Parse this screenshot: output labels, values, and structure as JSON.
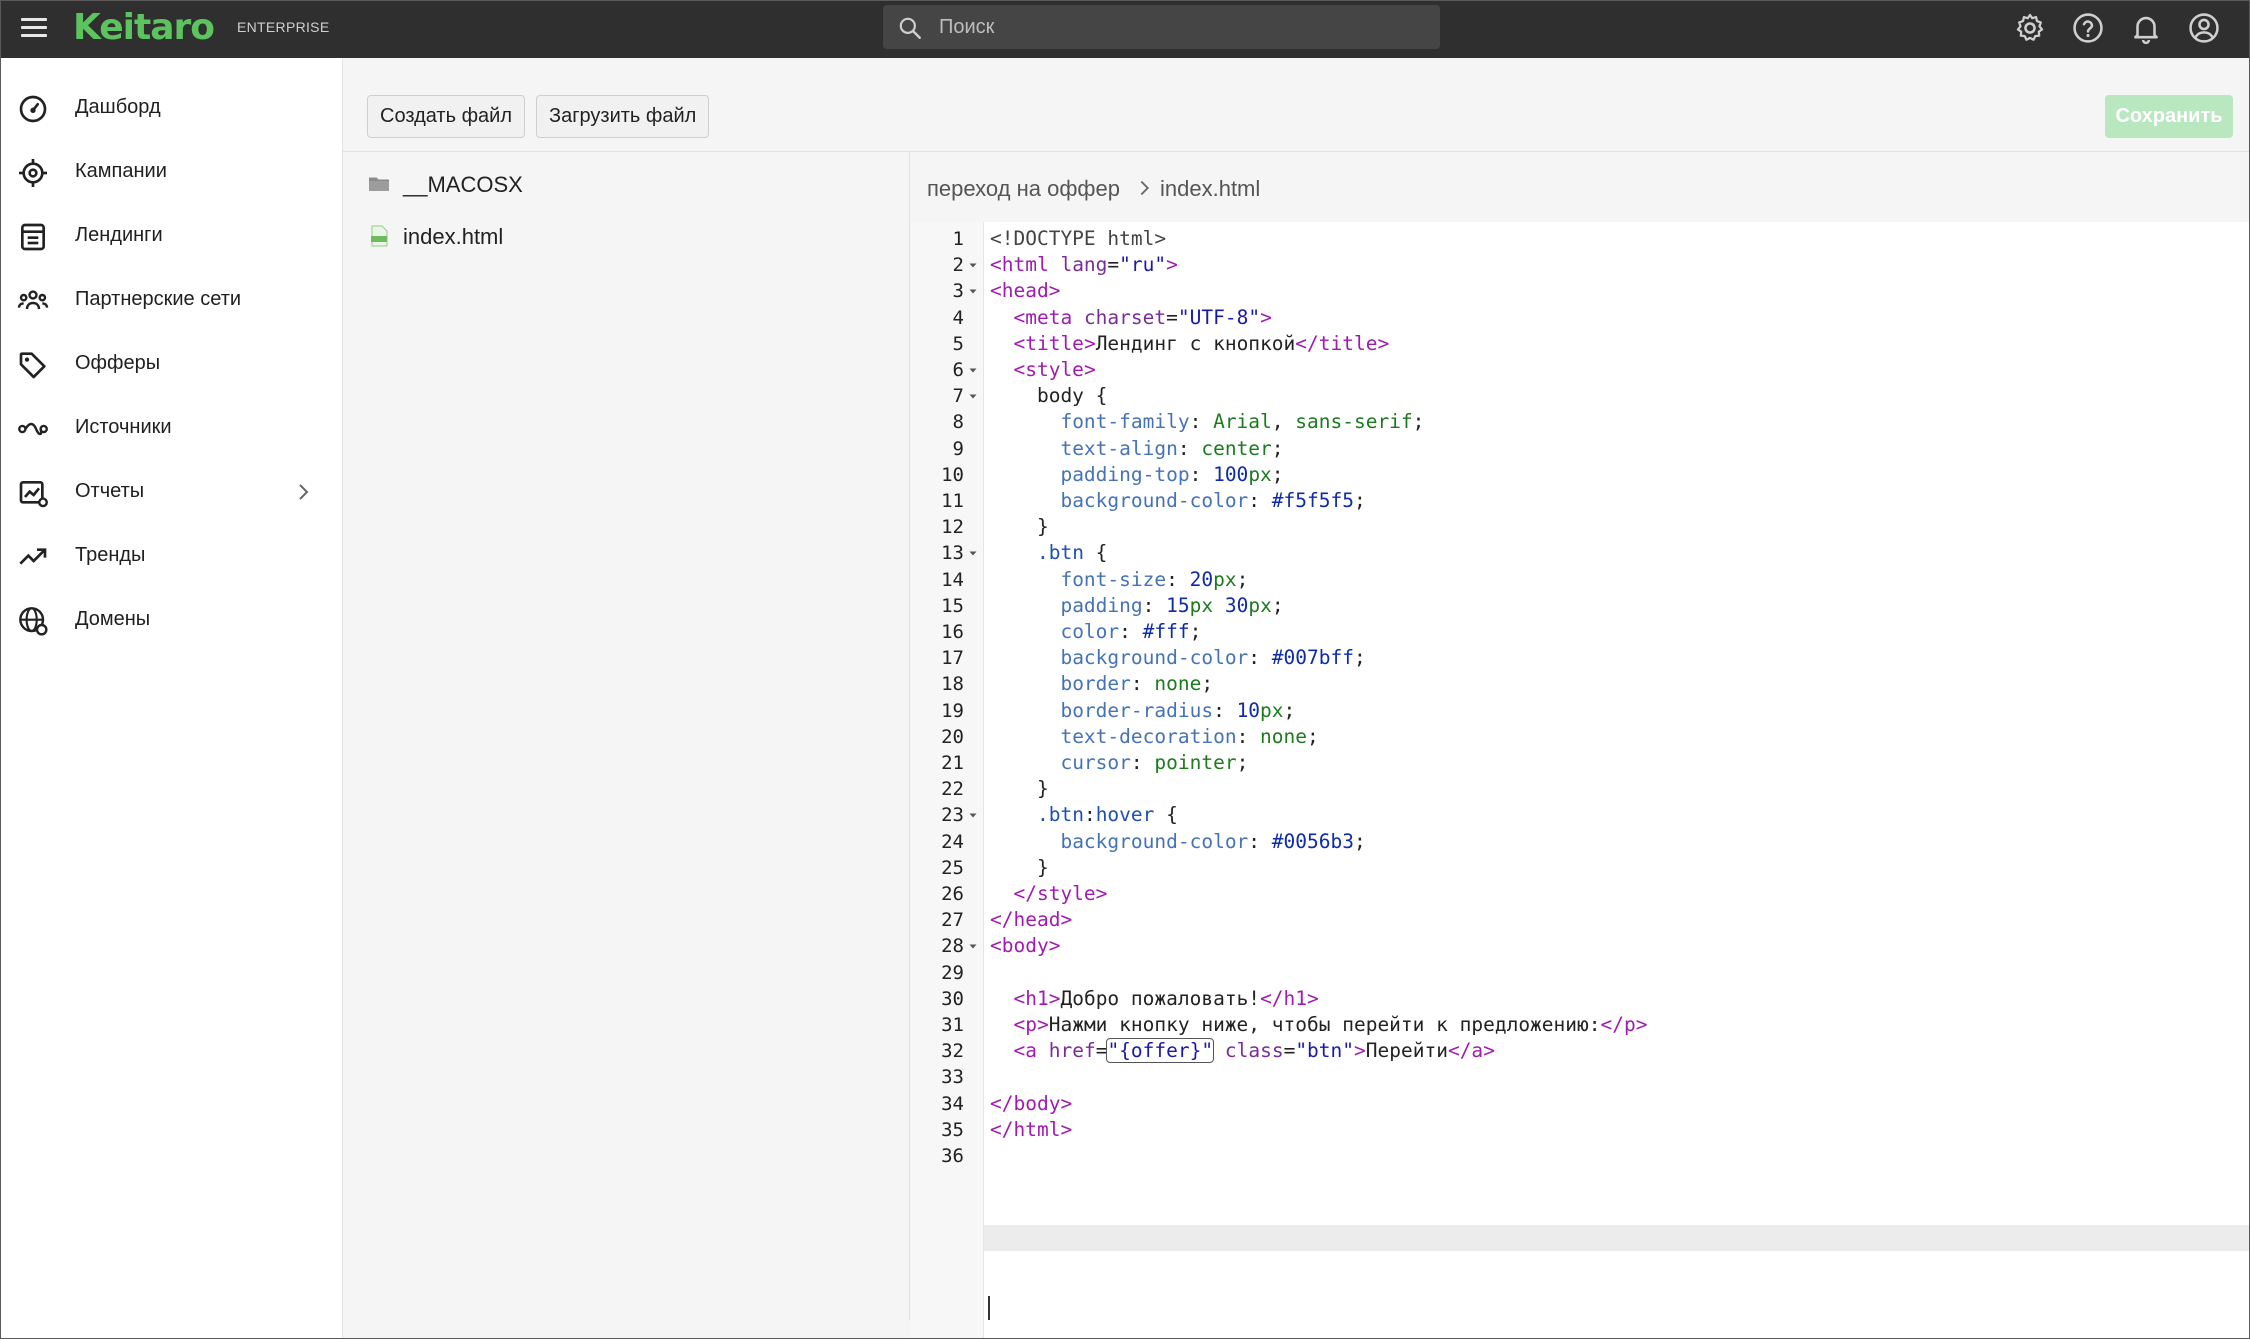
{
  "topbar": {
    "logo": "Keitaro",
    "edition": "ENTERPRISE",
    "search_placeholder": "Поиск"
  },
  "sidebar": {
    "items": [
      {
        "label": "Дашборд",
        "icon": "dashboard-icon"
      },
      {
        "label": "Кампании",
        "icon": "target-icon"
      },
      {
        "label": "Лендинги",
        "icon": "landing-page-icon"
      },
      {
        "label": "Партнерские сети",
        "icon": "partners-icon"
      },
      {
        "label": "Офферы",
        "icon": "tag-icon"
      },
      {
        "label": "Источники",
        "icon": "sources-icon"
      },
      {
        "label": "Отчеты",
        "icon": "reports-icon"
      },
      {
        "label": "Тренды",
        "icon": "trend-icon"
      },
      {
        "label": "Домены",
        "icon": "domain-globe-icon"
      }
    ]
  },
  "toolbar": {
    "create_file": "Создать файл",
    "upload_file": "Загрузить файл",
    "save": "Сохранить"
  },
  "files": [
    {
      "name": "__MACOSX",
      "type": "folder"
    },
    {
      "name": "index.html",
      "type": "html-file"
    }
  ],
  "breadcrumb": {
    "folder": "переход на оффер",
    "file": "index.html"
  },
  "editor": {
    "line_numbers": [
      "1",
      "2",
      "3",
      "4",
      "5",
      "6",
      "7",
      "8",
      "9",
      "10",
      "11",
      "12",
      "13",
      "14",
      "15",
      "16",
      "17",
      "18",
      "19",
      "20",
      "21",
      "22",
      "23",
      "24",
      "25",
      "26",
      "27",
      "28",
      "29",
      "30",
      "31",
      "32",
      "33",
      "34",
      "35",
      "36"
    ],
    "foldable_lines": [
      2,
      3,
      6,
      7,
      13,
      23,
      28
    ],
    "lines": [
      "<!DOCTYPE html>",
      "<html lang=\"ru\">",
      "<head>",
      "  <meta charset=\"UTF-8\">",
      "  <title>Лендинг с кнопкой</title>",
      "  <style>",
      "    body {",
      "      font-family: Arial, sans-serif;",
      "      text-align: center;",
      "      padding-top: 100px;",
      "      background-color: #f5f5f5;",
      "    }",
      "    .btn {",
      "      font-size: 20px;",
      "      padding: 15px 30px;",
      "      color: #fff;",
      "      background-color: #007bff;",
      "      border: none;",
      "      border-radius: 10px;",
      "      text-decoration: none;",
      "      cursor: pointer;",
      "    }",
      "    .btn:hover {",
      "      background-color: #0056b3;",
      "    }",
      "  </style>",
      "</head>",
      "<body>",
      "",
      "  <h1>Добро пожаловать!</h1>",
      "  <p>Нажми кнопку ниже, чтобы перейти к предложению:</p>",
      "  <a href=\"{offer}\" class=\"btn\">Перейти</a>",
      "",
      "</body>",
      "</html>",
      ""
    ]
  }
}
